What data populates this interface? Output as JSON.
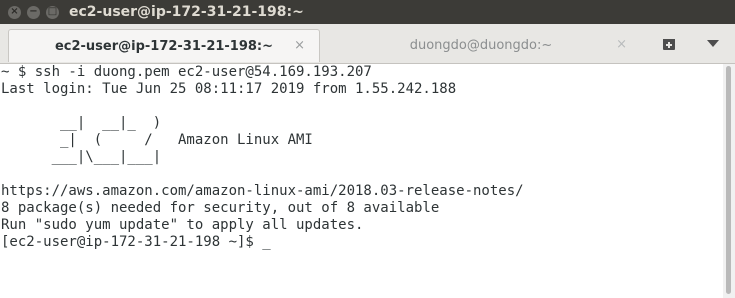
{
  "window": {
    "title": "ec2-user@ip-172-31-21-198:~",
    "buttons": [
      "×",
      "−",
      "□"
    ]
  },
  "tabs": [
    {
      "label": "ec2-user@ip-172-31-21-198:~",
      "close": "×",
      "active": true
    },
    {
      "label": "duongdo@duongdo:~",
      "close": "×",
      "active": false
    }
  ],
  "toolbar": {
    "new_tab_icon": "new-tab-icon",
    "menu_icon": "chevron-down-icon"
  },
  "terminal": {
    "lines": [
      "~ $ ssh -i duong.pem ec2-user@54.169.193.207",
      "Last login: Tue Jun 25 08:11:17 2019 from 1.55.242.188",
      "",
      "       __|  __|_  )",
      "       _|  (     /   Amazon Linux AMI",
      "      ___|\\___|___|",
      "",
      "https://aws.amazon.com/amazon-linux-ami/2018.03-release-notes/",
      "8 package(s) needed for security, out of 8 available",
      "Run \"sudo yum update\" to apply all updates.",
      "[ec2-user@ip-172-31-21-198 ~]$ _"
    ]
  },
  "colors": {
    "titlebar": "#3c3b37",
    "terminal_bg": "#ffffff",
    "terminal_fg": "#2e3436"
  }
}
